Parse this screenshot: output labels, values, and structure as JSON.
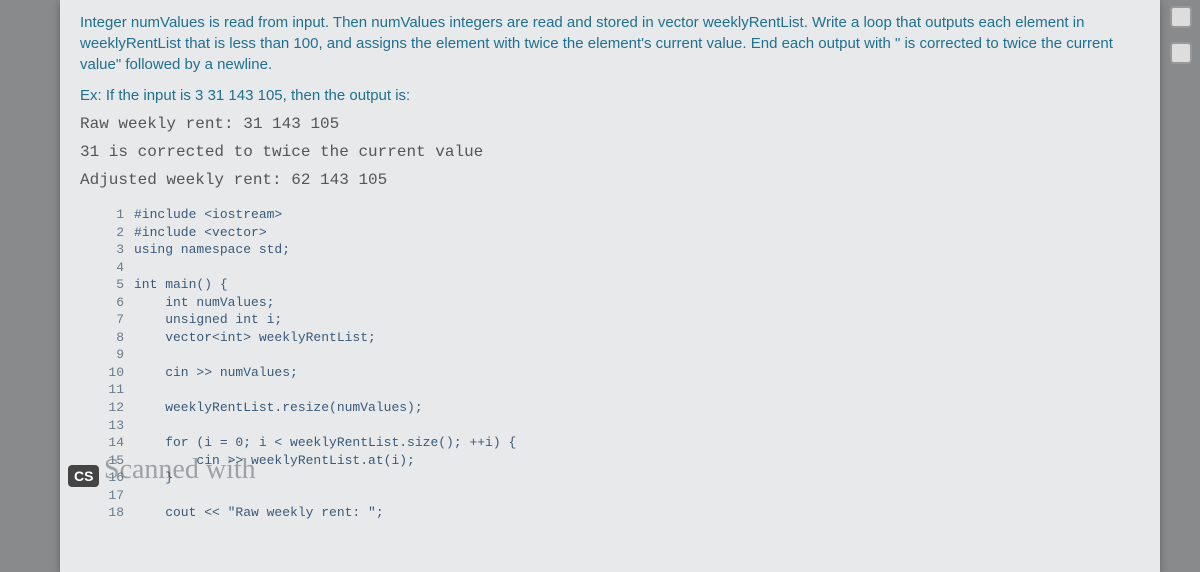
{
  "problem": {
    "p1": "Integer numValues is read from input. Then numValues integers are read and stored in vector weeklyRentList. Write a loop that outputs each element in weeklyRentList that is less than 100, and assigns the element with twice the element's current value. End each output with \" is corrected to twice the current value\" followed by a newline.",
    "example_label": "Ex: If the input is 3 31 143 105, then the output is:",
    "out1": "Raw weekly rent: 31 143 105",
    "out2": "31 is corrected to twice the current value",
    "out3": "Adjusted weekly rent: 62 143 105"
  },
  "code": {
    "lines": [
      {
        "n": "1",
        "t": "#include <iostream>"
      },
      {
        "n": "2",
        "t": "#include <vector>"
      },
      {
        "n": "3",
        "t": "using namespace std;"
      },
      {
        "n": "4",
        "t": ""
      },
      {
        "n": "5",
        "t": "int main() {"
      },
      {
        "n": "6",
        "t": "    int numValues;"
      },
      {
        "n": "7",
        "t": "    unsigned int i;"
      },
      {
        "n": "8",
        "t": "    vector<int> weeklyRentList;"
      },
      {
        "n": "9",
        "t": ""
      },
      {
        "n": "10",
        "t": "    cin >> numValues;"
      },
      {
        "n": "11",
        "t": ""
      },
      {
        "n": "12",
        "t": "    weeklyRentList.resize(numValues);"
      },
      {
        "n": "13",
        "t": ""
      },
      {
        "n": "14",
        "t": "    for (i = 0; i < weeklyRentList.size(); ++i) {"
      },
      {
        "n": "15",
        "t": "        cin >> weeklyRentList.at(i);"
      },
      {
        "n": "16",
        "t": "    }"
      },
      {
        "n": "17",
        "t": ""
      },
      {
        "n": "18",
        "t": "    cout << \"Raw weekly rent: \";"
      }
    ]
  },
  "badge": "CS",
  "watermark": "Scanned with"
}
